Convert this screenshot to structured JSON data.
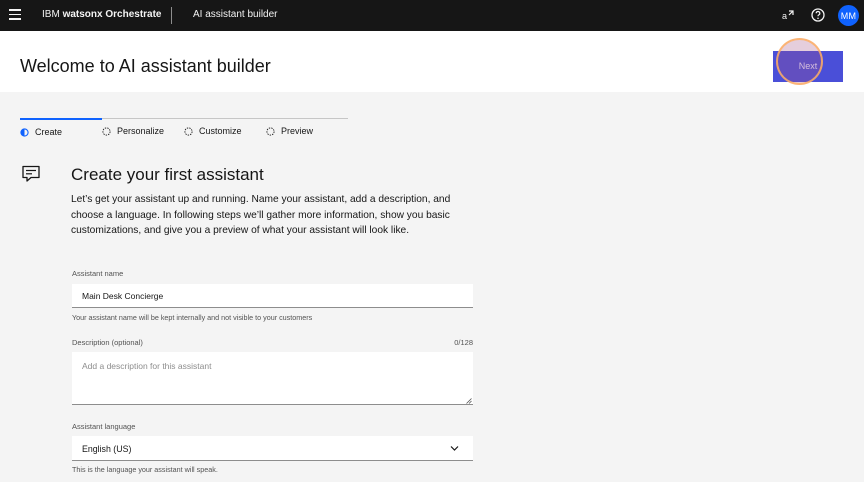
{
  "topbar": {
    "brand_prefix": "IBM ",
    "brand_product": "watsonx Orchestrate",
    "app_name": "AI assistant builder",
    "avatar_initials": "MM",
    "icons": [
      "menu-icon",
      "connect-icon",
      "help-icon"
    ]
  },
  "header": {
    "title": "Welcome to AI assistant builder",
    "next_label": "Next"
  },
  "progress": {
    "steps": [
      {
        "label": "Create",
        "state": "current"
      },
      {
        "label": "Personalize",
        "state": "incomplete"
      },
      {
        "label": "Customize",
        "state": "incomplete"
      },
      {
        "label": "Preview",
        "state": "incomplete"
      }
    ]
  },
  "main": {
    "icon": "chat-icon",
    "title": "Create your first assistant",
    "description": "Let’s get your assistant up and running. Name your assistant, add a description, and choose a language. In following steps we’ll gather more information, show you basic customizations, and give you a preview of what your assistant will look like."
  },
  "form": {
    "name": {
      "label": "Assistant name",
      "value": "Main Desk Concierge",
      "helper": "Your assistant name will be kept internally and not visible to your customers"
    },
    "description": {
      "label": "Description (optional)",
      "counter": "0/128",
      "placeholder": "Add a description for this assistant",
      "value": ""
    },
    "language": {
      "label": "Assistant language",
      "value": "English (US)",
      "helper": "This is the language your assistant will speak."
    }
  },
  "colors": {
    "topbar": "#161616",
    "accent": "#0f62fe",
    "next_button": "#4a4fd8",
    "background": "#f4f4f4"
  }
}
